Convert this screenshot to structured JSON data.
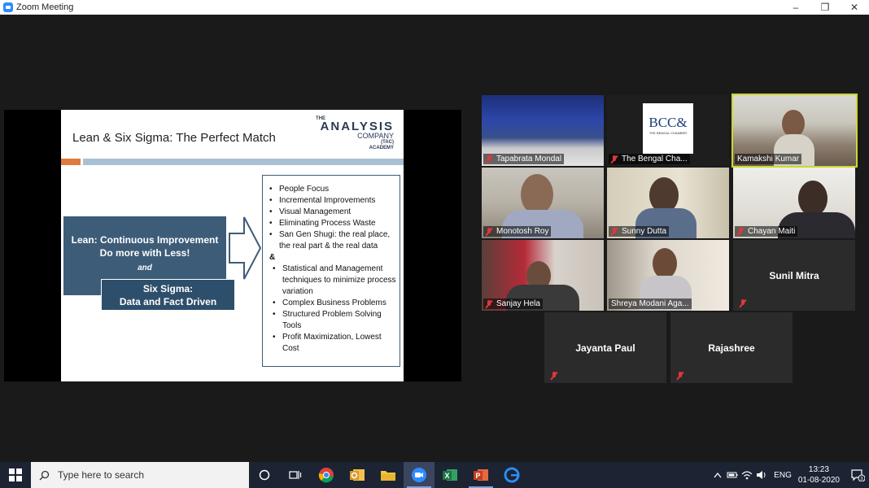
{
  "window": {
    "title": "Zoom Meeting",
    "controls": [
      "–",
      "❐",
      "✕"
    ]
  },
  "slide": {
    "title": "Lean & Six Sigma: The Perfect Match",
    "logo": {
      "line1": "THE",
      "line2": "ANALYSIS",
      "line3": "COMPANY",
      "tag": "(TAC)",
      "line4": "ACADEMY"
    },
    "lean_line1": "Lean: Continuous Improvement",
    "lean_line2": "Do more with Less!",
    "and": "and",
    "sigma_line1": "Six Sigma:",
    "sigma_line2": "Data and Fact Driven",
    "bullets_lean": [
      "People Focus",
      "Incremental Improvements",
      "Visual Management",
      "Eliminating Process Waste",
      "San Gen Shugi: the real place, the real part & the real data"
    ],
    "ampersand": "&",
    "bullets_sigma": [
      "Statistical and Management techniques to minimize process variation",
      "Complex Business Problems",
      "Structured Problem Solving Tools",
      "Profit Maximization, Lowest Cost"
    ]
  },
  "participants": [
    {
      "name": "Tapabrata Mondal",
      "muted": true
    },
    {
      "name": "The Bengal Cha...",
      "muted": true,
      "logo_text": "BCC&",
      "logo_sub": "THE BENGAL CHAMBER"
    },
    {
      "name": "Kamakshi Kumar",
      "muted": false,
      "active_speaker": true
    },
    {
      "name": "Monotosh Roy",
      "muted": true
    },
    {
      "name": "Sunny Dutta",
      "muted": true
    },
    {
      "name": "Chayan Maiti",
      "muted": true
    },
    {
      "name": "Sanjay Hela",
      "muted": true
    },
    {
      "name": "Shreya Modani Aga...",
      "muted": false
    },
    {
      "name": "Sunil Mitra",
      "muted": true,
      "video_off": true
    },
    {
      "name": "Jayanta Paul",
      "muted": true,
      "video_off": true
    },
    {
      "name": "Rajashree",
      "muted": true,
      "video_off": true
    }
  ],
  "taskbar": {
    "search_placeholder": "Type here to search",
    "language": "ENG",
    "time": "13:23",
    "date": "01-08-2020",
    "notifications": "3"
  }
}
